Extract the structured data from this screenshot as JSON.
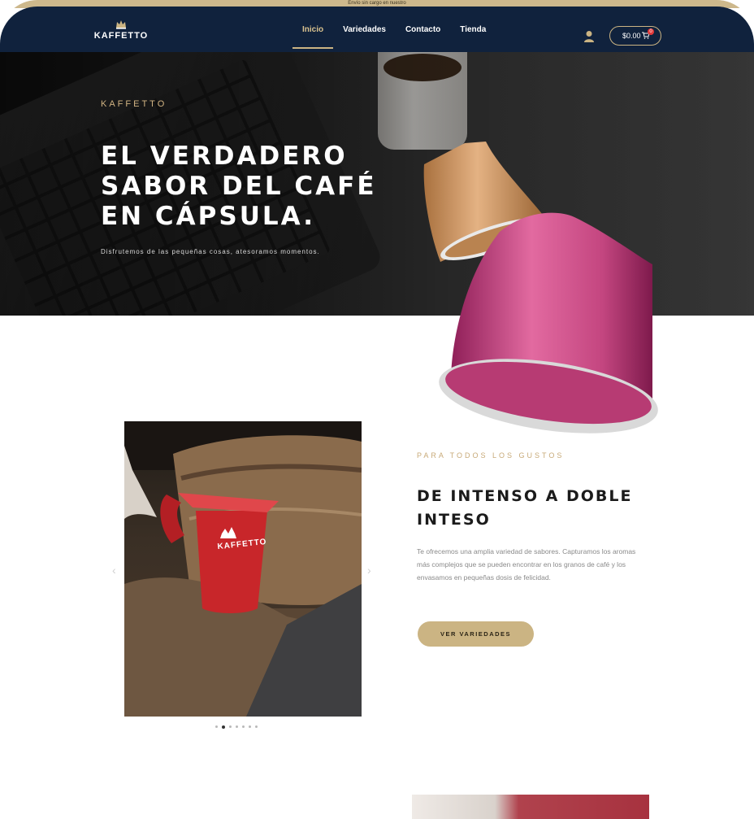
{
  "top_strip": {
    "text": "Envío sin cargo en nuestro"
  },
  "brand": {
    "name": "KAFFETTO"
  },
  "nav": {
    "links": [
      {
        "label": "Inicio",
        "active": true
      },
      {
        "label": "Variedades",
        "active": false
      },
      {
        "label": "Contacto",
        "active": false
      },
      {
        "label": "Tienda",
        "active": false
      }
    ],
    "cart_total": "$0.00",
    "cart_count": "0"
  },
  "hero": {
    "eyebrow": "KAFFETTO",
    "title": "EL VERDADERO SABOR DEL CAFÉ EN CÁPSULA.",
    "subtitle": "Disfrutemos de las pequeñas cosas, atesoramos momentos."
  },
  "section2": {
    "eyebrow": "PARA TODOS LOS GUSTOS",
    "title": "DE INTENSO A DOBLE INTESO",
    "body": "Te ofrecemos una amplia variedad de sabores. Capturamos los aromas más complejos que se pueden encontrar en los granos de café y los envasamos en pequeñas dosis de felicidad.",
    "cta": "VER VARIEDADES",
    "mug_label": "KAFFETTO",
    "arrows": {
      "prev": "‹",
      "next": "›"
    }
  },
  "colors": {
    "navy": "#10223d",
    "gold": "#cbb483",
    "capsule_gold": "#c98f5a",
    "capsule_pink": "#c8457f",
    "mug_red": "#c8262a"
  },
  "icons": [
    "crown-logo-icon",
    "user-icon",
    "cart-icon",
    "chevron-left-icon",
    "chevron-right-icon"
  ]
}
